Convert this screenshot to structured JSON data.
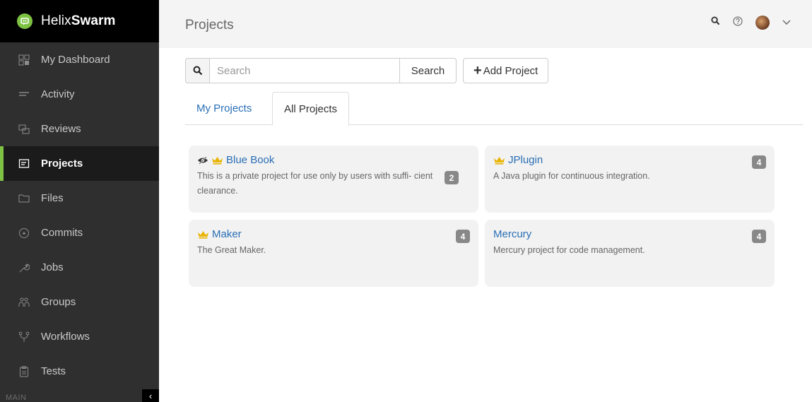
{
  "brand": {
    "prefix": "Helix",
    "suffix": "Swarm"
  },
  "sidebar": {
    "items": [
      {
        "label": "My Dashboard",
        "icon": "dashboard-icon"
      },
      {
        "label": "Activity",
        "icon": "activity-icon"
      },
      {
        "label": "Reviews",
        "icon": "reviews-icon"
      },
      {
        "label": "Projects",
        "icon": "projects-icon",
        "active": true
      },
      {
        "label": "Files",
        "icon": "folder-icon"
      },
      {
        "label": "Commits",
        "icon": "commit-icon"
      },
      {
        "label": "Jobs",
        "icon": "wrench-icon"
      },
      {
        "label": "Groups",
        "icon": "groups-icon"
      },
      {
        "label": "Workflows",
        "icon": "workflow-icon"
      },
      {
        "label": "Tests",
        "icon": "tests-icon"
      }
    ],
    "section_label": "MAIN",
    "collapse_glyph": "‹"
  },
  "header": {
    "title": "Projects"
  },
  "toolbar": {
    "search_placeholder": "Search",
    "search_button": "Search",
    "add_plus": "+",
    "add_label": "Add Project"
  },
  "tabs": [
    {
      "label": "My Projects",
      "active": false
    },
    {
      "label": "All Projects",
      "active": true
    }
  ],
  "projects": [
    {
      "name": "Blue Book",
      "description": "This is a private project for use only by users with suffi- cient clearance.",
      "count": "2",
      "private": true,
      "owner": true
    },
    {
      "name": "JPlugin",
      "description": "A Java plugin for continuous integration.",
      "count": "4",
      "private": false,
      "owner": true
    },
    {
      "name": "Maker",
      "description": "The Great Maker.",
      "count": "4",
      "private": false,
      "owner": true
    },
    {
      "name": "Mercury",
      "description": "Mercury project for code management.",
      "count": "4",
      "private": false,
      "owner": false
    }
  ],
  "colors": {
    "accent": "#7dc242",
    "link": "#2a6fb5",
    "crown": "#e8b400",
    "sidebar_bg": "#2f2f2f"
  }
}
